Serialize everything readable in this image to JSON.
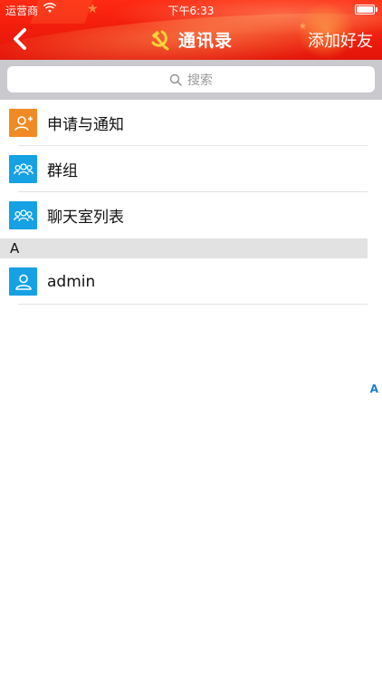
{
  "status_bar": {
    "carrier": "运营商",
    "time": "下午6:33"
  },
  "nav": {
    "title": "通讯录",
    "right_action": "添加好友",
    "back_icon": "chevron-left-icon",
    "title_icon": "hammer-sickle-icon"
  },
  "search": {
    "placeholder": "搜索"
  },
  "list": {
    "top_items": [
      {
        "label": "申请与通知",
        "icon": "add-user-icon",
        "color": "#f08a24"
      },
      {
        "label": "群组",
        "icon": "group-icon",
        "color": "#15a1e4"
      },
      {
        "label": "聊天室列表",
        "icon": "group-icon",
        "color": "#15a1e4"
      }
    ],
    "section_letter": "A",
    "contacts": [
      {
        "label": "admin",
        "icon": "user-icon",
        "color": "#15a1e4"
      }
    ]
  },
  "index_bar": {
    "letter": "A"
  },
  "colors": {
    "header_red": "#f21d0c",
    "accent_blue": "#15a1e4",
    "accent_orange": "#f08a24",
    "index_blue": "#1a7bd6"
  }
}
